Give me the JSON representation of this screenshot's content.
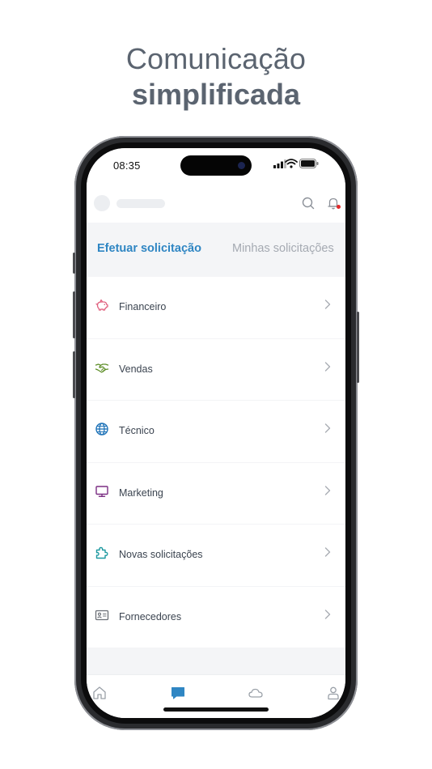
{
  "headline": {
    "line1": "Comunicação",
    "line2": "simplificada"
  },
  "status_bar": {
    "time": "08:35"
  },
  "tabs": [
    {
      "label": "Efetuar solicitação",
      "active": true
    },
    {
      "label": "Minhas solicitações",
      "active": false
    }
  ],
  "categories": [
    {
      "label": "Financeiro",
      "icon": "piggy-bank-icon",
      "color": "#e0607e"
    },
    {
      "label": "Vendas",
      "icon": "handshake-icon",
      "color": "#5f8f2a"
    },
    {
      "label": "Técnico",
      "icon": "globe-icon",
      "color": "#1f73b8"
    },
    {
      "label": "Marketing",
      "icon": "monitor-icon",
      "color": "#7b2e83"
    },
    {
      "label": "Novas solicitações",
      "icon": "puzzle-icon",
      "color": "#1f9aa1"
    },
    {
      "label": "Fornecedores",
      "icon": "id-card-icon",
      "color": "#6b6f76"
    }
  ],
  "colors": {
    "accent": "#2f86c3",
    "notification": "#e02a2a",
    "inactive_tab": "#a5aab2"
  }
}
